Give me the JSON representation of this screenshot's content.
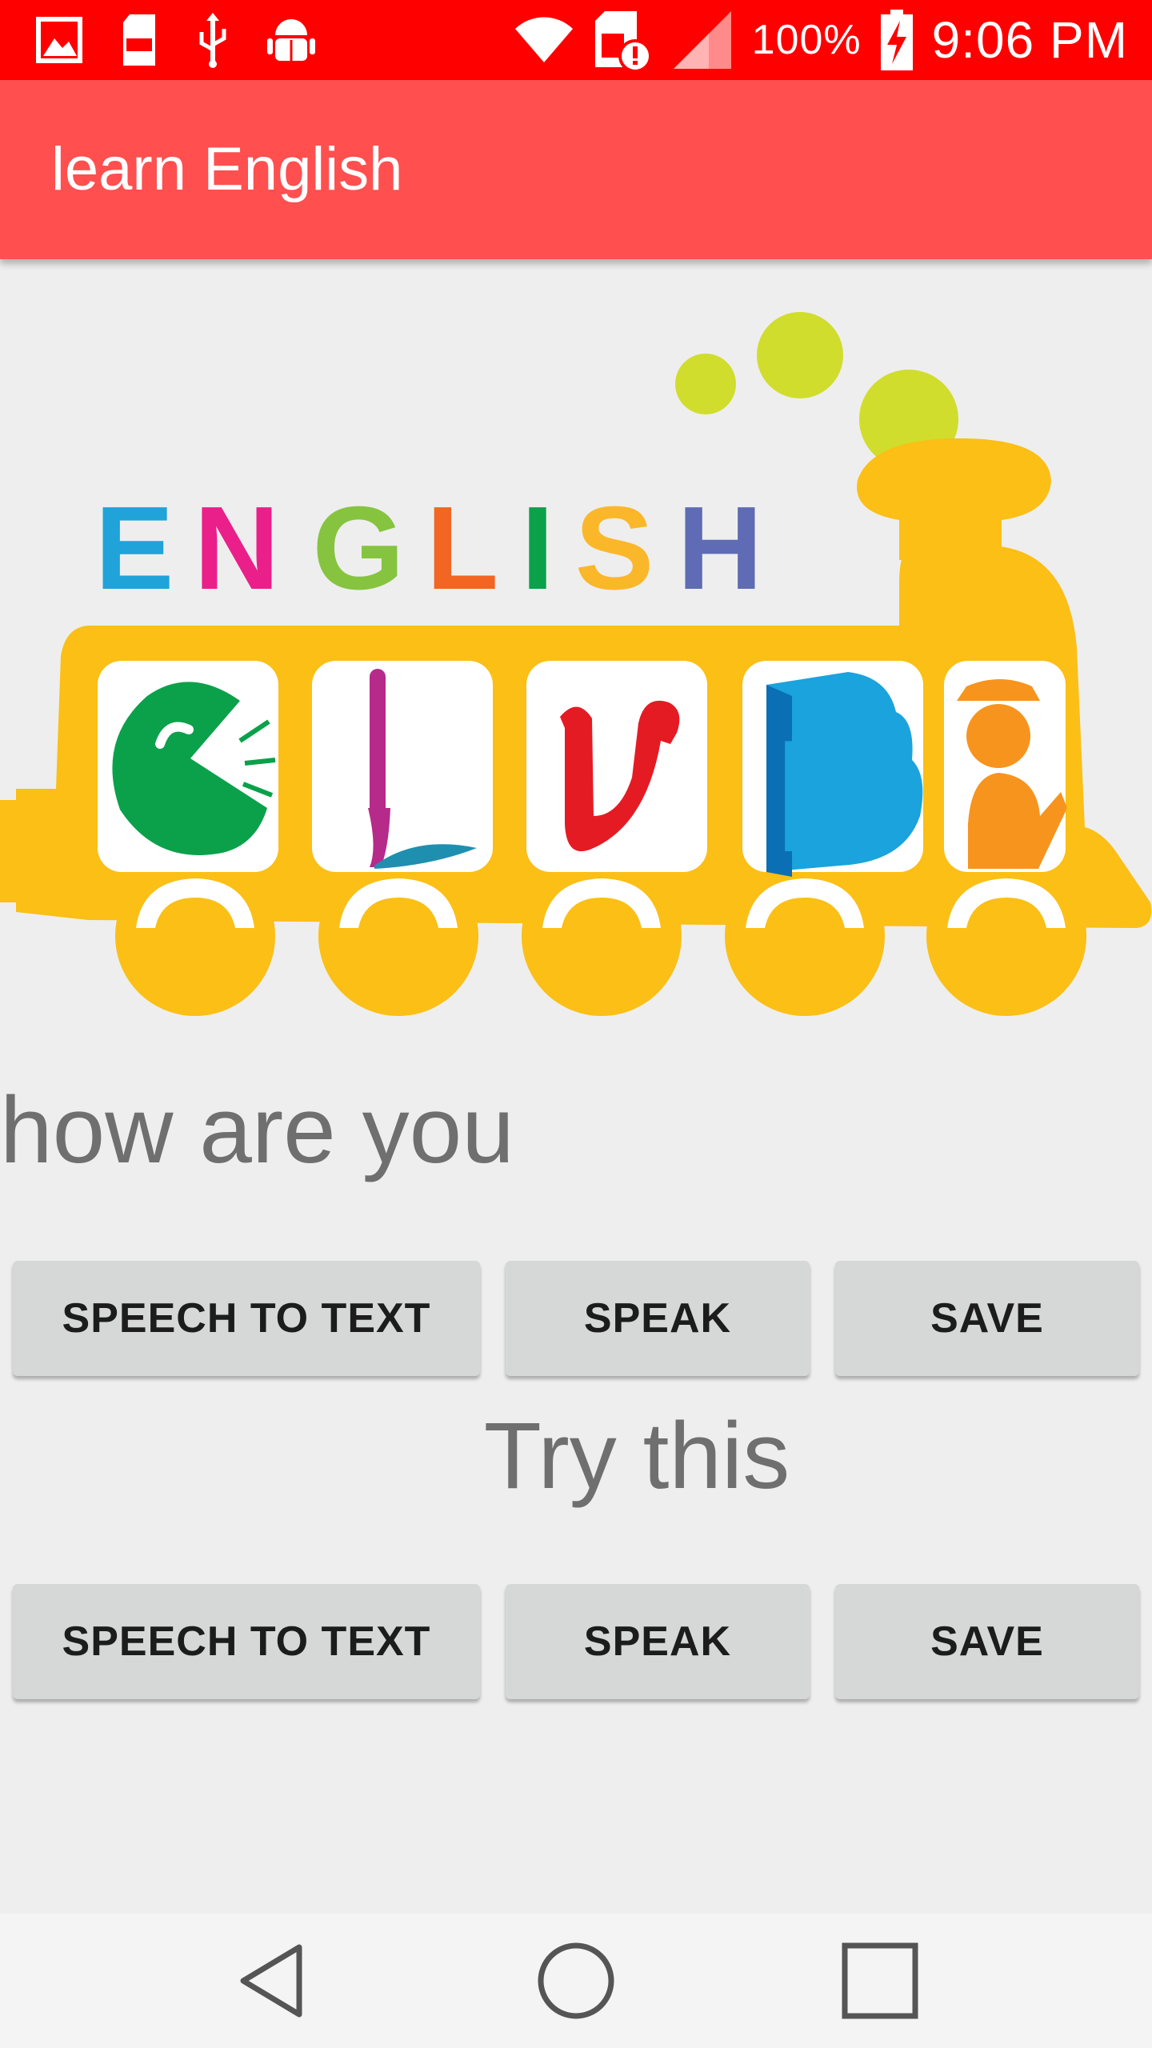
{
  "status_bar": {
    "time": "9:06 PM",
    "battery_percent": "100%",
    "icons": [
      "gallery-icon",
      "sd-card-100-icon",
      "usb-icon",
      "android-debug-icon",
      "wifi-icon",
      "sim-alert-icon",
      "signal-icon",
      "battery-charging-icon"
    ]
  },
  "app_bar": {
    "title": "learn English"
  },
  "banner": {
    "word": "ENGLISH",
    "letters": [
      "E",
      "N",
      "G",
      "L",
      "I",
      "S",
      "H"
    ],
    "letter_colors": [
      "#1fa3d8",
      "#ea1f8a",
      "#86c440",
      "#f26522",
      "#0aa14a",
      "#fbb72a",
      "#5f6bb4"
    ]
  },
  "main": {
    "phrase": "how are you",
    "prompt": "Try this",
    "row1": {
      "speech_to_text": "SPEECH TO TEXT",
      "speak": "SPEAK",
      "save": "SAVE"
    },
    "row2": {
      "speech_to_text": "SPEECH TO TEXT",
      "speak": "SPEAK",
      "save": "SAVE"
    }
  },
  "nav_bar": {
    "icons": [
      "back-icon",
      "home-icon",
      "recents-icon"
    ]
  },
  "colors": {
    "status_bar": "#ff0000",
    "app_bar": "#ff4f4f",
    "background": "#eeeeee",
    "button": "#d6d7d7",
    "text_gray": "#6f6f6f"
  }
}
